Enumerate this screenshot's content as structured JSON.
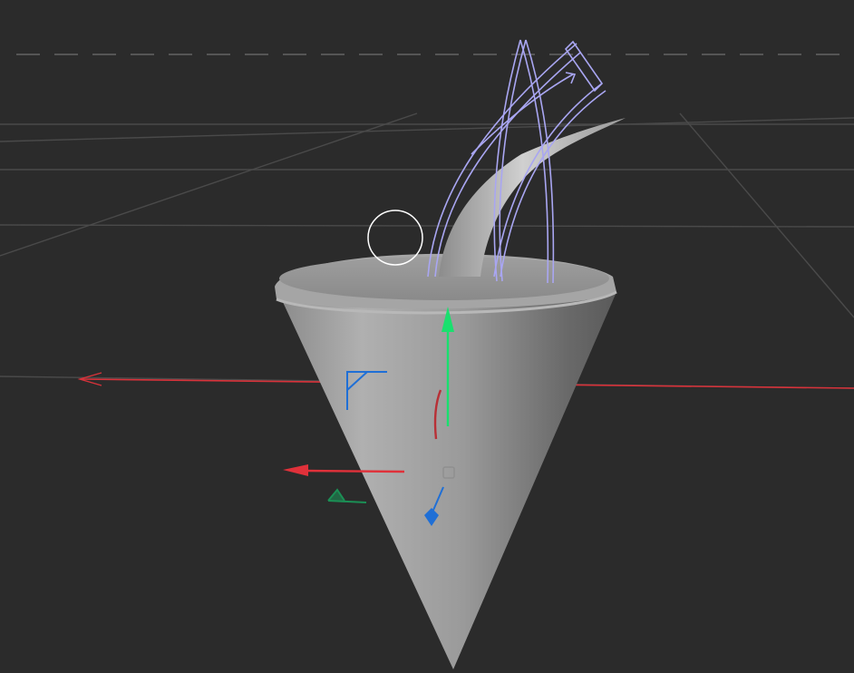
{
  "viewport": {
    "background": "#2b2b2b",
    "grid_color": "#4a4a4a",
    "horizon_color": "#555555"
  },
  "colors": {
    "x_axis": "#e0313a",
    "y_axis": "#19e06e",
    "z_axis": "#1f6fd6",
    "spline": "#a9a6f2",
    "cone_light": "#c8c8c8",
    "cone_dark": "#5a5a5a",
    "cursor": "#ffffff"
  },
  "objects": {
    "cone": "cone-object",
    "horn": "horn-object",
    "spline_guide": "spline-guide"
  },
  "gizmo": {
    "move_y_icon": "arrow-up-icon",
    "move_x_icon": "arrow-left-icon",
    "move_z_icon": "diamond-handle-icon",
    "plane_xz_icon": "corner-bracket-icon",
    "center_icon": "cube-center-icon"
  }
}
